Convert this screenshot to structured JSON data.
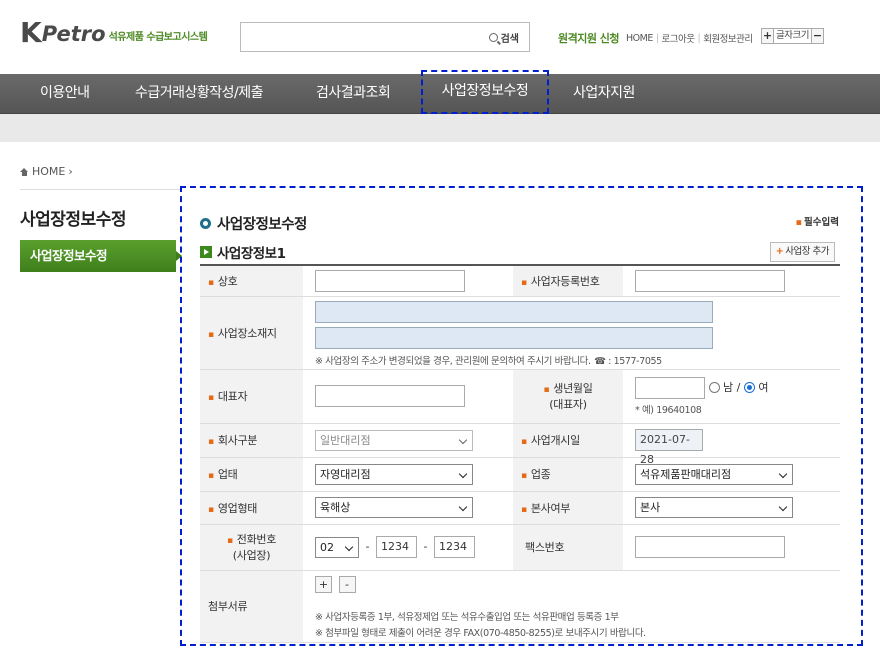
{
  "header": {
    "logo_k": "K",
    "logo_petro": "Petro",
    "logo_sub": "석유제품 수급보고시스템",
    "search_placeholder": "",
    "search_button": "검색",
    "remote_support": "원격지원 신청",
    "links": [
      "HOME",
      "로그아웃",
      "회원정보관리"
    ],
    "fontsize_plus": "+",
    "fontsize_label": "글자크기",
    "fontsize_minus": "−"
  },
  "nav": {
    "items": [
      "이용안내",
      "수급거래상황작성/제출",
      "검사결과조회",
      "사업장정보수정",
      "사업자지원"
    ]
  },
  "breadcrumb": {
    "home": "HOME"
  },
  "sidebar": {
    "title": "사업장정보수정",
    "items": [
      "사업장정보수정"
    ]
  },
  "main": {
    "title": "사업장정보수정",
    "required_note": "필수입력",
    "section_title": "사업장정보1",
    "add_button": "사업장 추가",
    "fields": {
      "company_label": "상호",
      "company_value": "",
      "bizno_label": "사업자등록번호",
      "bizno_value": "",
      "address_label": "사업장소재지",
      "address_note": "※ 사업장의 주소가 변경되었을 경우, 관리원에 문의하여 주시기 바랍니다.",
      "address_phone": "☎ : 1577-7055",
      "rep_label": "대표자",
      "birth_label_1": "생년월일",
      "birth_label_2": "(대표자)",
      "gender_male": "남",
      "gender_sep": "/",
      "gender_female": "여",
      "birth_example": "* 예) 19640108",
      "company_type_label": "회사구분",
      "company_type_value": "일반대리점",
      "open_date_label": "사업개시일",
      "open_date_value": "2021-07-28",
      "business_label": "업태",
      "business_value": "자영대리점",
      "industry_label": "업종",
      "industry_value": "석유제품판매대리점",
      "sales_type_label": "영업형태",
      "sales_type_value": "육해상",
      "hq_label": "본사여부",
      "hq_value": "본사",
      "phone_label_1": "전화번호",
      "phone_label_2": "(사업장)",
      "phone_area": "02",
      "phone_mid": "1234",
      "phone_last": "1234",
      "phone_dash": "-",
      "fax_label": "팩스번호",
      "attach_label": "첨부서류",
      "attach_plus": "+",
      "attach_minus": "-",
      "attach_note_1": "※ 사업자등록증 1부, 석유정제업 또는 석유수출입업 또는 석유판매업 등록증 1부",
      "attach_note_2": "※ 첨부파일 형태로 제출이 어려운 경우 FAX(070-4850-8255)로 보내주시기 바랍니다."
    }
  },
  "colors": {
    "accent_green": "#4d8a23",
    "nav_bg": "#5f5f5f",
    "bullet_orange": "#e56a16",
    "highlight_dashed": "#0020d0"
  }
}
